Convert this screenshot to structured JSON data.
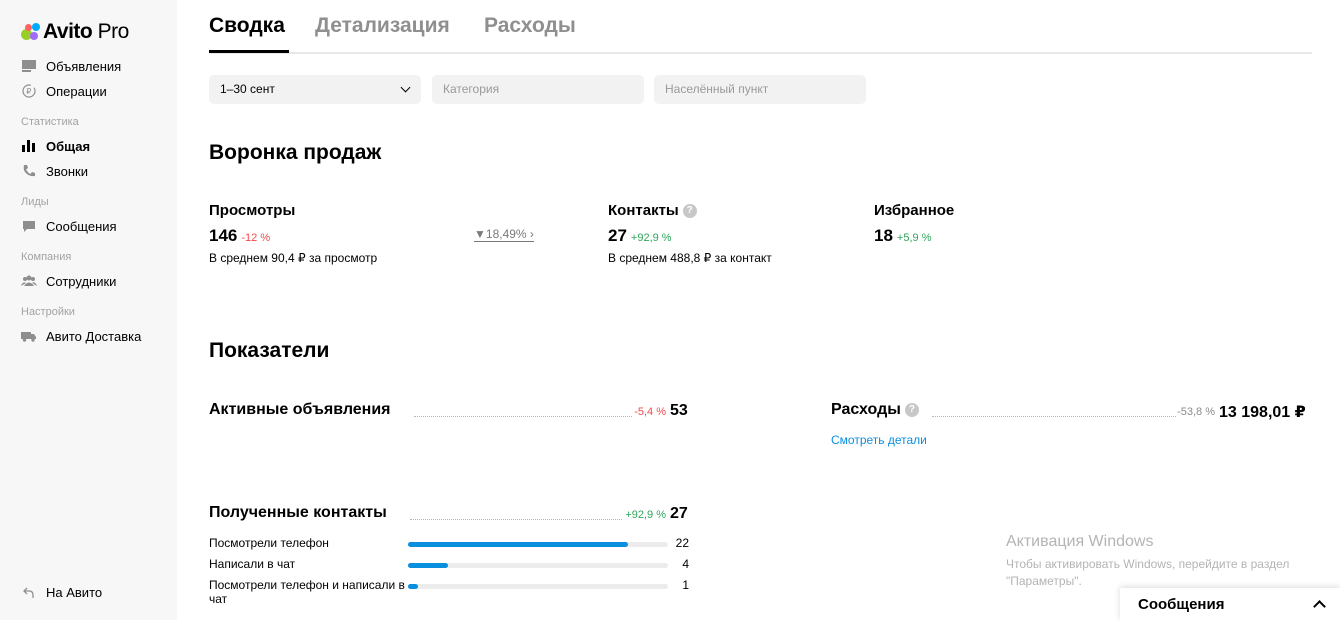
{
  "sidebar": {
    "logo_text": "Avito",
    "logo_suffix": "Pro",
    "logo_dot_colors": [
      "#97cf26",
      "#a169f7",
      "#ff6163",
      "#00aaff"
    ],
    "items": [
      {
        "label": "Объявления",
        "icon": "listings-icon"
      },
      {
        "label": "Операции",
        "icon": "operations-icon"
      },
      {
        "label": "Общая",
        "icon": "bar-chart-icon",
        "active": true
      },
      {
        "label": "Звонки",
        "icon": "phone-icon"
      },
      {
        "label": "Сообщения",
        "icon": "chat-icon"
      },
      {
        "label": "Сотрудники",
        "icon": "users-icon"
      },
      {
        "label": "Авито Доставка",
        "icon": "truck-icon"
      }
    ],
    "sections": [
      "Статистика",
      "Лиды",
      "Компания",
      "Настройки"
    ],
    "back_label": "На Авито"
  },
  "tabs": [
    "Сводка",
    "Детализация",
    "Расходы"
  ],
  "filters": {
    "date": "1–30 сент",
    "category_placeholder": "Категория",
    "city_placeholder": "Населённый пункт"
  },
  "funnel": {
    "title": "Воронка продаж",
    "views": {
      "title": "Просмотры",
      "value": "146",
      "delta": "-12 %",
      "sub": "В среднем 90,4 ₽ за просмотр"
    },
    "conversion": "18,49%",
    "contacts": {
      "title": "Контакты",
      "value": "27",
      "delta": "+92,9 %",
      "sub": "В среднем 488,8 ₽ за контакт"
    },
    "favorites": {
      "title": "Избранное",
      "value": "18",
      "delta": "+5,9 %"
    }
  },
  "indicators": {
    "title": "Показатели",
    "active_ads": {
      "title": "Активные объявления",
      "delta": "-5,4 %",
      "value": "53"
    },
    "expenses": {
      "title": "Расходы",
      "delta": "-53,8 %",
      "value": "13 198,01 ₽",
      "link": "Смотреть детали"
    },
    "contacts": {
      "title": "Полученные контакты",
      "delta": "+92,9 %",
      "value": "27",
      "rows": [
        {
          "label": "Посмотрели телефон",
          "value": 22
        },
        {
          "label": "Написали в чат",
          "value": 4
        },
        {
          "label": "Посмотрели телефон и написали в чат",
          "value": 1
        }
      ]
    }
  },
  "windows_watermark": {
    "title": "Активация Windows",
    "text": "Чтобы активировать Windows, перейдите в раздел \"Параметры\"."
  },
  "messages_panel": {
    "label": "Сообщения"
  },
  "colors": {
    "accent": "#0a8ede",
    "negative": "#f44a4a",
    "positive": "#2fa55a"
  }
}
